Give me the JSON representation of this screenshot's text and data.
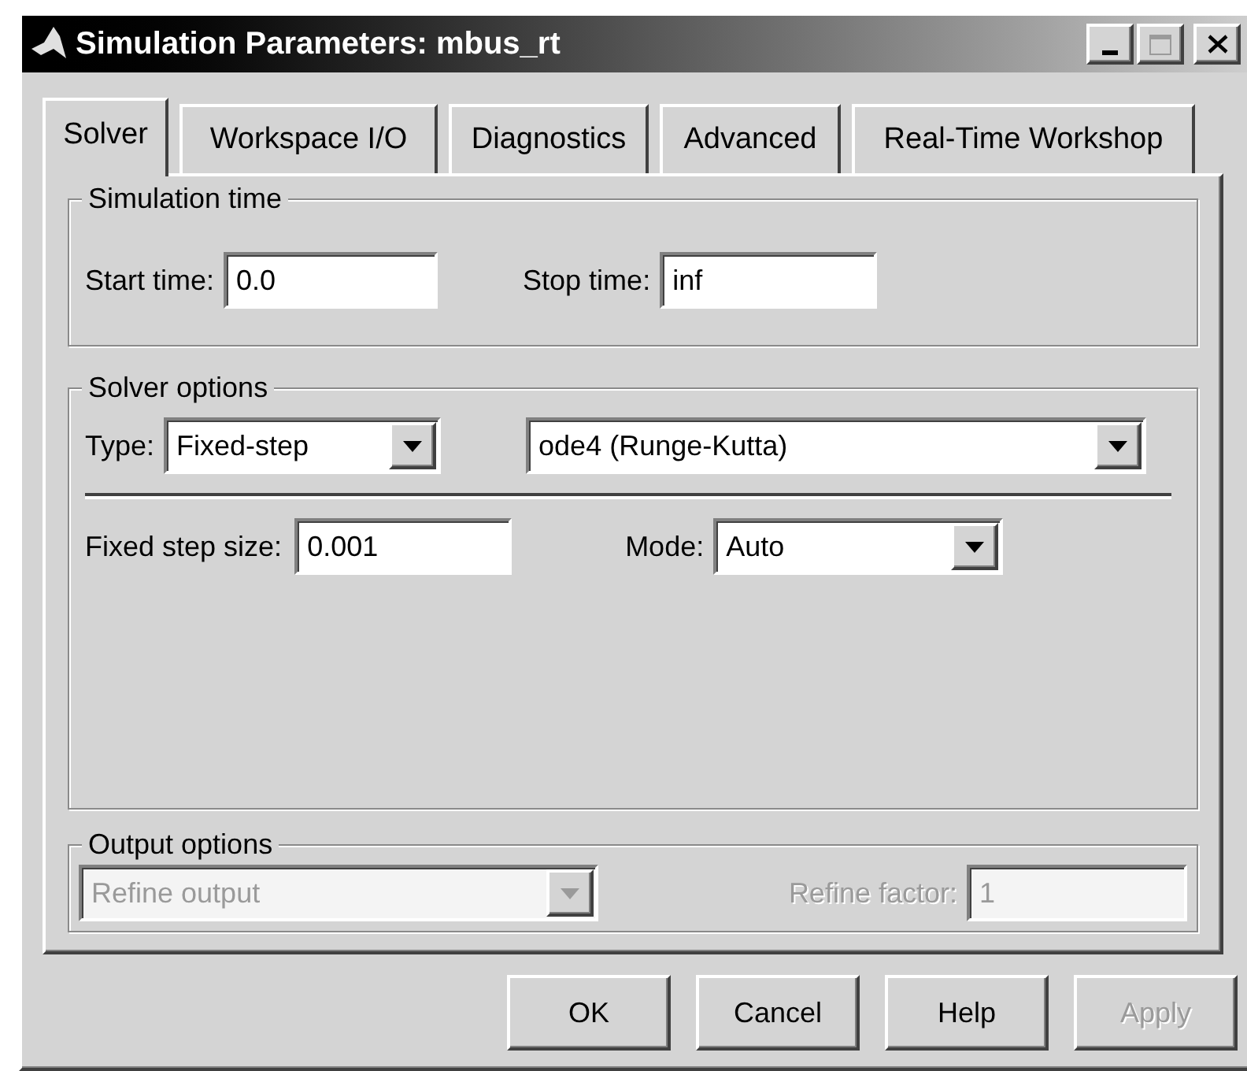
{
  "window": {
    "title": "Simulation Parameters: mbus_rt"
  },
  "tabs": [
    {
      "label": "Solver",
      "selected": true
    },
    {
      "label": "Workspace I/O",
      "selected": false
    },
    {
      "label": "Diagnostics",
      "selected": false
    },
    {
      "label": "Advanced",
      "selected": false
    },
    {
      "label": "Real-Time Workshop",
      "selected": false
    }
  ],
  "simulation_time": {
    "legend": "Simulation time",
    "start_time": {
      "label": "Start time:",
      "value": "0.0"
    },
    "stop_time": {
      "label": "Stop time:",
      "value": "inf"
    }
  },
  "solver_options": {
    "legend": "Solver options",
    "type": {
      "label": "Type:",
      "value": "Fixed-step"
    },
    "solver": {
      "value": "ode4 (Runge-Kutta)"
    },
    "fixed_step_size": {
      "label": "Fixed step size:",
      "value": "0.001"
    },
    "mode": {
      "label": "Mode:",
      "value": "Auto"
    }
  },
  "output_options": {
    "legend": "Output options",
    "output": {
      "value": "Refine output",
      "disabled": true
    },
    "refine_factor": {
      "label": "Refine factor:",
      "value": "1",
      "disabled": true
    }
  },
  "buttons": [
    {
      "label": "OK",
      "disabled": false
    },
    {
      "label": "Cancel",
      "disabled": false
    },
    {
      "label": "Help",
      "disabled": false
    },
    {
      "label": "Apply",
      "disabled": true
    }
  ]
}
